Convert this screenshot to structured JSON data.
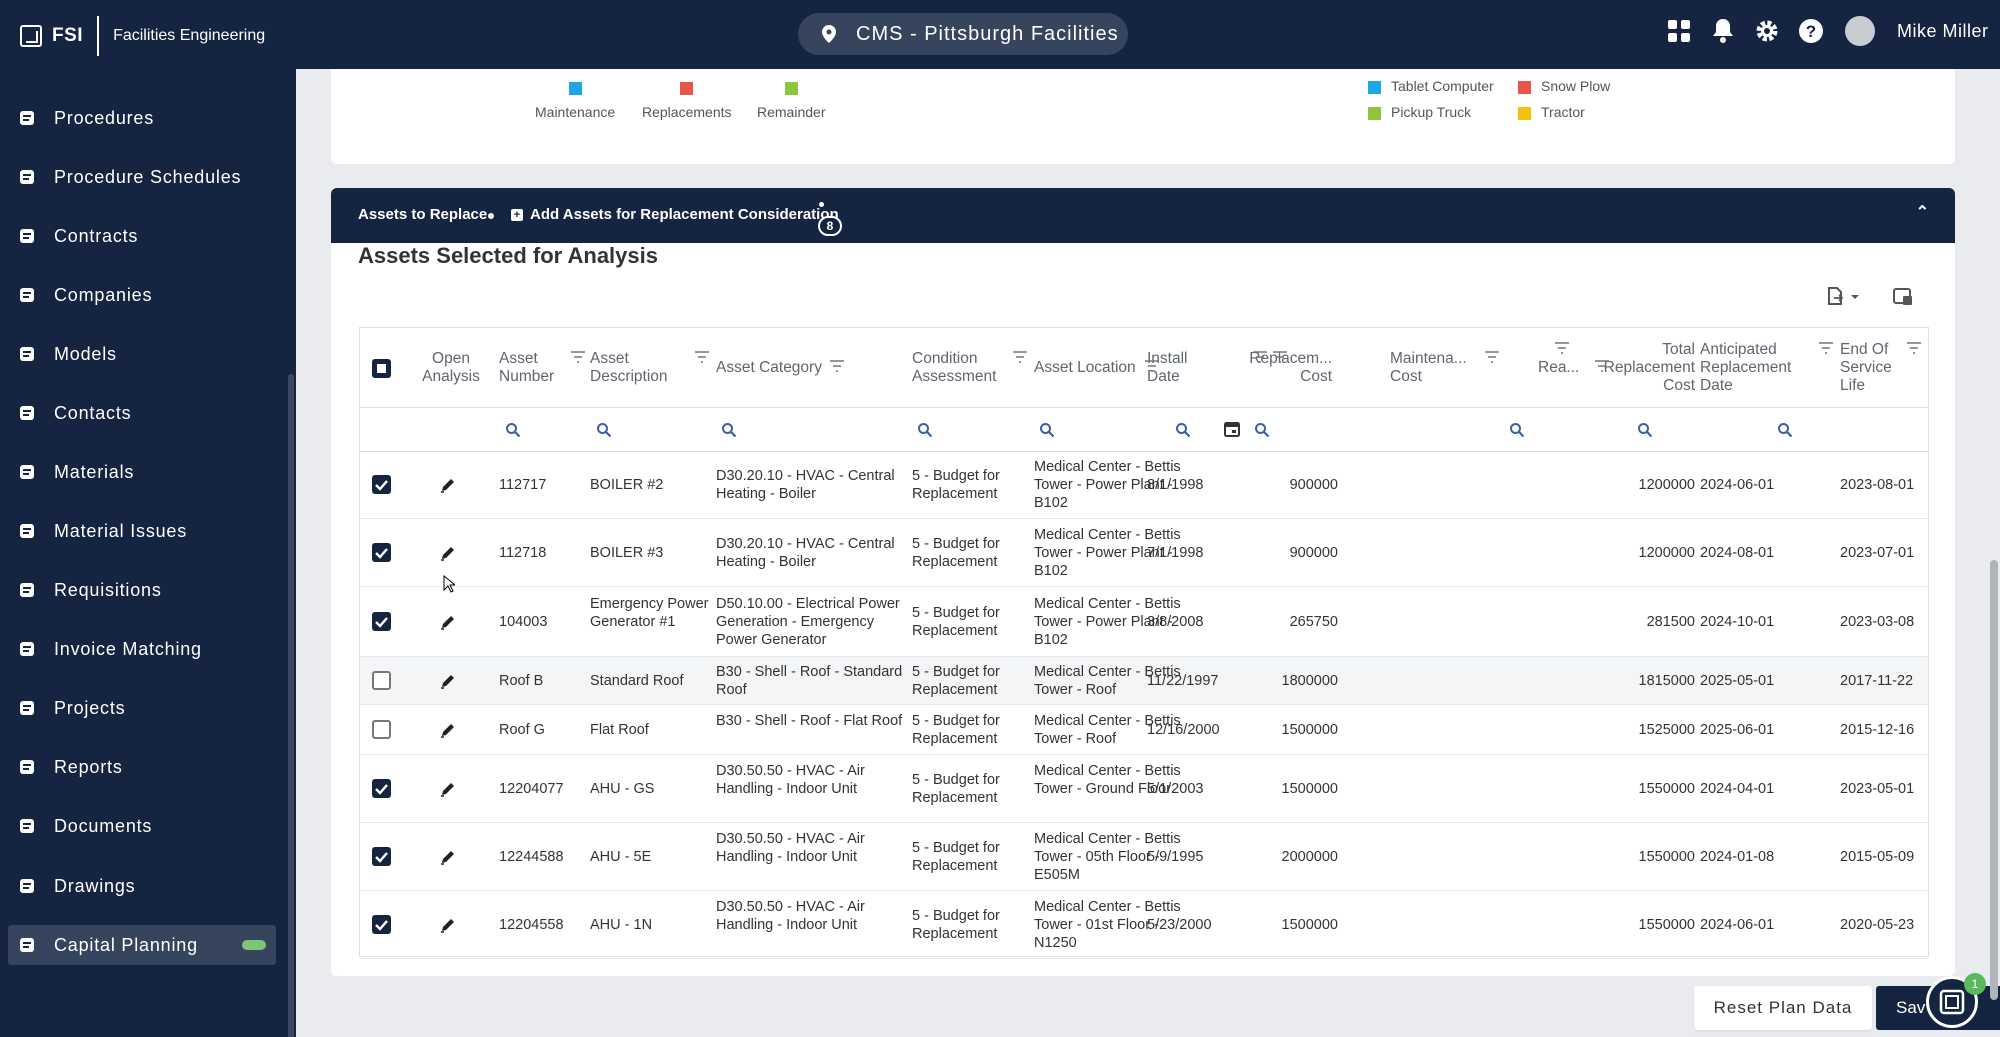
{
  "app": {
    "brand": "FSI",
    "org": "Facilities Engineering",
    "site": "CMS - Pittsburgh Facilities",
    "user": "Mike Miller"
  },
  "sidebar": {
    "items": [
      {
        "label": "Procedures",
        "icon": "procedures-icon"
      },
      {
        "label": "Procedure Schedules",
        "icon": "calendar-icon"
      },
      {
        "label": "Contracts",
        "icon": "contract-icon"
      },
      {
        "label": "Companies",
        "icon": "building-icon"
      },
      {
        "label": "Models",
        "icon": "model-icon"
      },
      {
        "label": "Contacts",
        "icon": "contact-card-icon"
      },
      {
        "label": "Materials",
        "icon": "materials-icon"
      },
      {
        "label": "Material Issues",
        "icon": "issues-icon"
      },
      {
        "label": "Requisitions",
        "icon": "cart-icon"
      },
      {
        "label": "Invoice Matching",
        "icon": "invoice-icon"
      },
      {
        "label": "Projects",
        "icon": "projects-icon"
      },
      {
        "label": "Reports",
        "icon": "reports-icon"
      },
      {
        "label": "Documents",
        "icon": "folder-icon"
      },
      {
        "label": "Drawings",
        "icon": "drawing-icon"
      },
      {
        "label": "Capital Planning",
        "icon": "capital-planning-icon",
        "active": true
      }
    ]
  },
  "legend": {
    "left": [
      {
        "label": "Maintenance",
        "color": "#1ea7e8"
      },
      {
        "label": "Replacements",
        "color": "#e8534a"
      },
      {
        "label": "Remainder",
        "color": "#8cc63f"
      }
    ],
    "right": [
      {
        "label": "Tablet Computer",
        "color": "#1ea7e8"
      },
      {
        "label": "Snow Plow",
        "color": "#e8534a"
      },
      {
        "label": "Pickup Truck",
        "color": "#8cc63f"
      },
      {
        "label": "Tractor",
        "color": "#f4c20d"
      }
    ]
  },
  "tabs": {
    "assets_to_replace": "Assets to Replace",
    "add_assets": "Add Assets for Replacement Consideration",
    "badge": "8"
  },
  "section": {
    "title": "Assets Selected for Analysis"
  },
  "columns": {
    "open_analysis": "Open Analysis",
    "asset_number": "Asset Number",
    "asset_description": "Asset Description",
    "asset_category": "Asset Category",
    "condition": "Condition Assessment",
    "location": "Asset Location",
    "install_date": "Install Date",
    "replacement_cost": "Replacem... Cost",
    "maintenance_cost": "Maintena... Cost",
    "rea": "Rea...",
    "total_replacement_cost": "Total Replacement Cost",
    "anticipated_replacement_date": "Anticipated Replacement Date",
    "end_of_service_life": "End Of Service Life"
  },
  "rows": [
    {
      "checked": true,
      "number": "112717",
      "description": "BOILER #2",
      "category": "D30.20.10 - HVAC - Central Heating - Boiler",
      "condition": "5 - Budget for Replacement",
      "location": "Medical Center - Bettis Tower - Power Plant - B102",
      "install": "8/1/1998",
      "replacement_cost": "900000",
      "total": "1200000",
      "anticipated": "2024-06-01",
      "eosl": "2023-08-01"
    },
    {
      "checked": true,
      "number": "112718",
      "description": "BOILER #3",
      "category": "D30.20.10 - HVAC - Central Heating - Boiler",
      "condition": "5 - Budget for Replacement",
      "location": "Medical Center - Bettis Tower - Power Plant - B102",
      "install": "7/1/1998",
      "replacement_cost": "900000",
      "total": "1200000",
      "anticipated": "2024-08-01",
      "eosl": "2023-07-01"
    },
    {
      "checked": true,
      "number": "104003",
      "description": "Emergency Power Generator #1",
      "category": "D50.10.00 - Electrical Power Generation - Emergency Power Generator",
      "condition": "5 - Budget for Replacement",
      "location": "Medical Center - Bettis Tower - Power Plant - B102",
      "install": "3/8/2008",
      "replacement_cost": "265750",
      "total": "281500",
      "anticipated": "2024-10-01",
      "eosl": "2023-03-08"
    },
    {
      "checked": false,
      "number": "Roof B",
      "description": "Standard Roof",
      "category": "B30 - Shell - Roof - Standard Roof",
      "condition": "5 - Budget for Replacement",
      "location": "Medical Center - Bettis Tower - Roof",
      "install": "11/22/1997",
      "replacement_cost": "1800000",
      "total": "1815000",
      "anticipated": "2025-05-01",
      "eosl": "2017-11-22"
    },
    {
      "checked": false,
      "number": "Roof G",
      "description": "Flat Roof",
      "category": "B30 - Shell - Roof - Flat Roof",
      "condition": "5 - Budget for Replacement",
      "location": "Medical Center - Bettis Tower - Roof",
      "install": "12/16/2000",
      "replacement_cost": "1500000",
      "total": "1525000",
      "anticipated": "2025-06-01",
      "eosl": "2015-12-16"
    },
    {
      "checked": true,
      "number": "12204077",
      "description": "AHU - GS",
      "category": "D30.50.50 - HVAC - Air Handling - Indoor Unit",
      "condition": "5 - Budget for Replacement",
      "location": "Medical Center - Bettis Tower - Ground Floor",
      "install": "5/1/2003",
      "replacement_cost": "1500000",
      "total": "1550000",
      "anticipated": "2024-04-01",
      "eosl": "2023-05-01"
    },
    {
      "checked": true,
      "number": "12244588",
      "description": "AHU - 5E",
      "category": "D30.50.50 - HVAC - Air Handling - Indoor Unit",
      "condition": "5 - Budget for Replacement",
      "location": "Medical Center - Bettis Tower - 05th Floor - E505M",
      "install": "5/9/1995",
      "replacement_cost": "2000000",
      "total": "1550000",
      "anticipated": "2024-01-08",
      "eosl": "2015-05-09"
    },
    {
      "checked": true,
      "number": "12204558",
      "description": "AHU - 1N",
      "category": "D30.50.50 - HVAC - Air Handling - Indoor Unit",
      "condition": "5 - Budget for Replacement",
      "location": "Medical Center - Bettis Tower - 01st Floor - N1250",
      "install": "5/23/2000",
      "replacement_cost": "1500000",
      "total": "1550000",
      "anticipated": "2024-06-01",
      "eosl": "2020-05-23"
    }
  ],
  "actions": {
    "reset": "Reset Plan Data",
    "save": "Sav"
  },
  "fab_badge": "1"
}
